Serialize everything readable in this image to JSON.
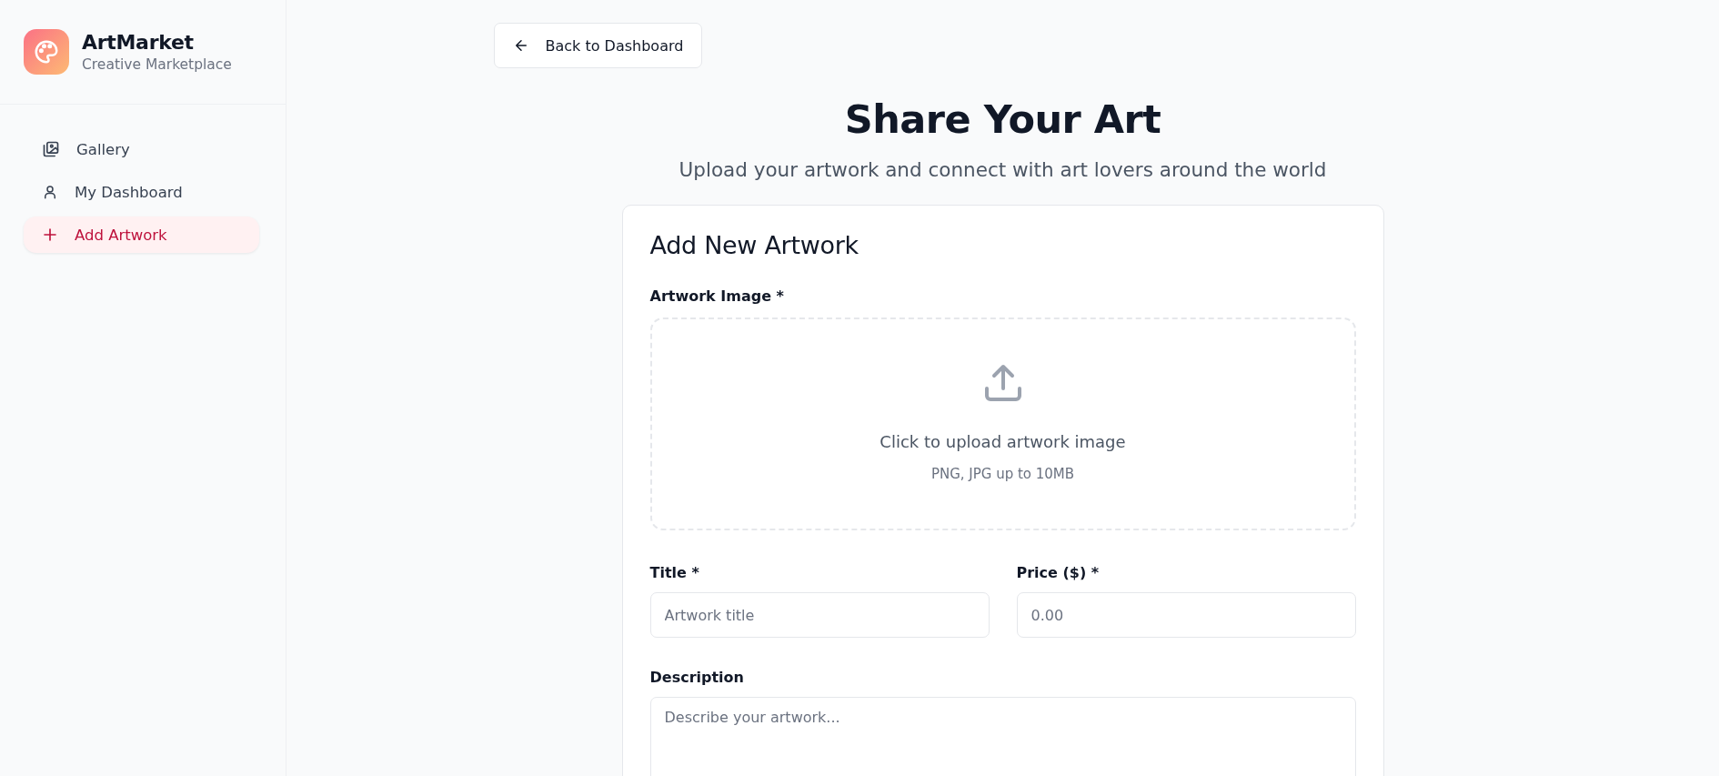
{
  "brand": {
    "name": "ArtMarket",
    "tagline": "Creative Marketplace"
  },
  "nav": [
    {
      "kind": "gallery",
      "label": "Gallery",
      "selected": false
    },
    {
      "kind": "user",
      "label": "My Dashboard",
      "selected": false
    },
    {
      "kind": "add",
      "label": "Add Artwork",
      "selected": true
    }
  ],
  "back_button": "Back to Dashboard",
  "heading": "Share Your Art",
  "subheading": "Upload your artwork and connect with art lovers around the world",
  "form": {
    "title": "Add New Artwork",
    "image_label": "Artwork Image *",
    "upload": {
      "prompt": "Click to upload artwork image",
      "hint": "PNG, JPG up to 10MB"
    },
    "fields": [
      {
        "kind": "input",
        "label": "Title *",
        "placeholder": "Artwork title"
      },
      {
        "kind": "input",
        "label": "Price ($) *",
        "placeholder": "0.00"
      },
      {
        "kind": "textarea",
        "label": "Description",
        "placeholder": "Describe your artwork..."
      }
    ]
  }
}
